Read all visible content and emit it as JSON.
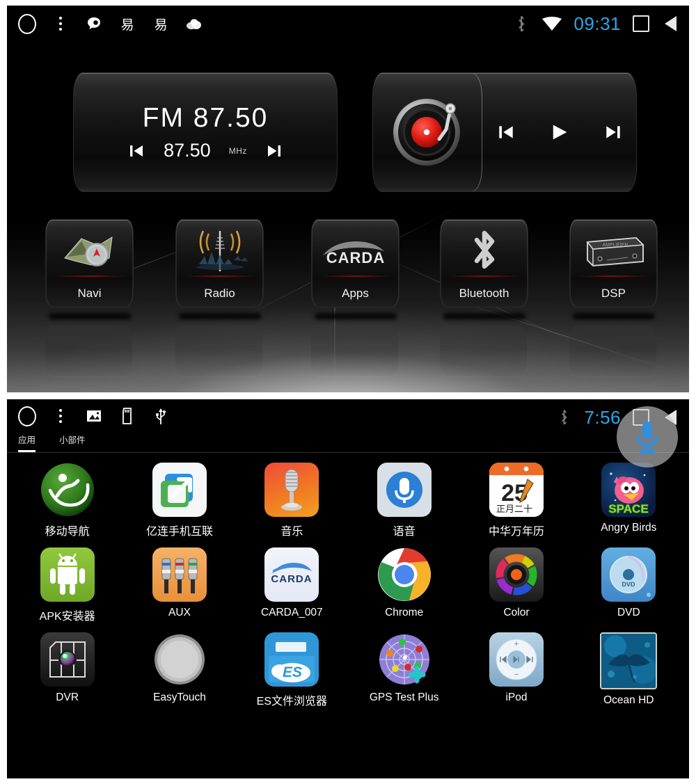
{
  "top_screen": {
    "statusbar": {
      "left_icons": [
        "home-circle-icon",
        "menu-dots-icon",
        "chat-bubble-icon",
        "yi-app-icon",
        "yi-app-icon-2",
        "cloud-weather-icon"
      ],
      "bluetooth_icon": "bluetooth-icon",
      "wifi_icon": "wifi-icon",
      "time": "09:31",
      "recents_icon": "recents-square-icon",
      "back_icon": "back-triangle-icon",
      "time_color": "#2aa8e8"
    },
    "fm_widget": {
      "band_and_freq": "FM  87.50",
      "frequency": "87.50",
      "unit": "MHz",
      "prev_icon": "prev-track-icon",
      "next_icon": "next-track-icon"
    },
    "music_widget": {
      "art_icon": "vinyl-turntable-icon",
      "prev_icon": "prev-track-icon",
      "play_icon": "play-icon",
      "next_icon": "next-track-icon"
    },
    "shortcuts": [
      {
        "label": "Navi",
        "icon": "map-compass-icon"
      },
      {
        "label": "Radio",
        "icon": "radio-tower-icon"
      },
      {
        "label": "Apps",
        "icon": "carda-logo-icon"
      },
      {
        "label": "Bluetooth",
        "icon": "bluetooth-icon"
      },
      {
        "label": "DSP",
        "icon": "amplifier-box-icon"
      }
    ]
  },
  "bottom_screen": {
    "statusbar": {
      "left_icons": [
        "home-circle-icon",
        "menu-dots-icon",
        "gallery-image-icon",
        "sd-card-icon",
        "usb-icon"
      ],
      "bluetooth_icon": "bluetooth-icon",
      "time": "7:56",
      "recents_icon": "recents-square-icon",
      "back_icon": "back-triangle-icon"
    },
    "tabs": [
      {
        "label": "应用",
        "active": true
      },
      {
        "label": "小部件",
        "active": false
      }
    ],
    "floating_button": {
      "icon": "microphone-icon",
      "color": "#2f8fe0"
    },
    "apps": [
      [
        {
          "label": "移动导航",
          "icon": "mobile-navigation-icon",
          "cn": true
        },
        {
          "label": "亿连手机互联",
          "icon": "elink-phone-connect-icon",
          "cn": true
        },
        {
          "label": "音乐",
          "icon": "music-microphone-icon",
          "cn": true
        },
        {
          "label": "语音",
          "icon": "voice-microphone-icon",
          "cn": true
        },
        {
          "label": "中华万年历",
          "icon": "chinese-calendar-icon",
          "cn": true
        },
        {
          "label": "Angry Birds",
          "icon": "angry-birds-space-icon",
          "cn": false
        }
      ],
      [
        {
          "label": "APK安装器",
          "icon": "android-apk-installer-icon",
          "cn": true
        },
        {
          "label": "AUX",
          "icon": "aux-rca-cable-icon",
          "cn": false
        },
        {
          "label": "CARDA_007",
          "icon": "carda-car-logo-icon",
          "cn": false
        },
        {
          "label": "Chrome",
          "icon": "chrome-browser-icon",
          "cn": false
        },
        {
          "label": "Color",
          "icon": "color-wheel-icon",
          "cn": false
        },
        {
          "label": "DVD",
          "icon": "dvd-disc-icon",
          "cn": false
        }
      ],
      [
        {
          "label": "DVR",
          "icon": "dvr-camera-icon",
          "cn": false
        },
        {
          "label": "EasyTouch",
          "icon": "easytouch-circle-icon",
          "cn": false
        },
        {
          "label": "ES文件浏览器",
          "icon": "es-file-explorer-icon",
          "cn": true
        },
        {
          "label": "GPS Test Plus",
          "icon": "gps-radar-icon",
          "cn": false
        },
        {
          "label": "iPod",
          "icon": "ipod-clickwheel-icon",
          "cn": false
        },
        {
          "label": "Ocean HD",
          "icon": "ocean-manta-ray-icon",
          "cn": false
        }
      ]
    ],
    "calendar_icon_text": {
      "day": "25",
      "lunar": "正月二十"
    }
  }
}
